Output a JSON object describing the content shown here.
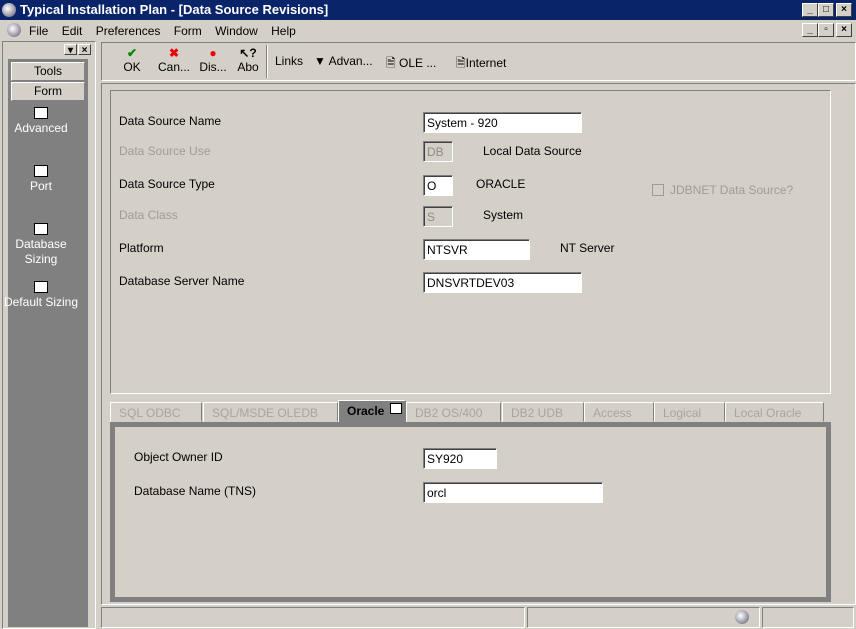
{
  "window": {
    "title": "Typical Installation Plan - [Data Source Revisions]"
  },
  "menu": [
    "File",
    "Edit",
    "Preferences",
    "Form",
    "Window",
    "Help"
  ],
  "toolbar": {
    "ok": "OK",
    "cancel": "Can...",
    "display": "Dis...",
    "about": "Abo",
    "links": "Links",
    "advanced": "Advan...",
    "ole": "OLE ...",
    "internet": "Internet"
  },
  "sidebar": {
    "tools": "Tools",
    "form": "Form",
    "items": [
      "Advanced",
      "Port",
      "Database Sizing",
      "Default Sizing"
    ]
  },
  "form": {
    "ds_name_label": "Data Source Name",
    "ds_name": "System - 920",
    "ds_use_label": "Data Source Use",
    "ds_use": "DB",
    "ds_use_desc": "Local Data Source",
    "ds_type_label": "Data Source Type",
    "ds_type": "O",
    "ds_type_desc": "ORACLE",
    "jdbnet_label": "JDBNET Data Source?",
    "data_class_label": "Data Class",
    "data_class": "S",
    "data_class_desc": "System",
    "platform_label": "Platform",
    "platform": "NTSVR",
    "platform_desc": "NT Server",
    "server_label": "Database Server Name",
    "server": "DNSVRTDEV03"
  },
  "tabs": [
    "SQL ODBC",
    "SQL/MSDE OLEDB",
    "Oracle",
    "DB2 OS/400",
    "DB2 UDB",
    "Access",
    "Logical",
    "Local Oracle"
  ],
  "oracle": {
    "owner_label": "Object Owner ID",
    "owner": "SY920",
    "tns_label": "Database Name (TNS)",
    "tns": "orcl"
  }
}
